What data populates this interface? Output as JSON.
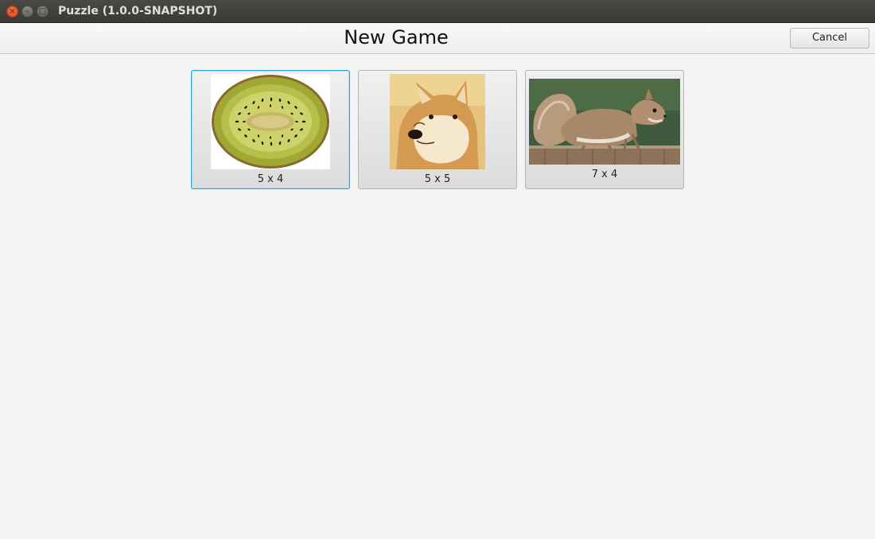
{
  "window": {
    "title": "Puzzle (1.0.0-SNAPSHOT)",
    "controls": {
      "close": "×",
      "minimize": "–",
      "maximize": "□"
    }
  },
  "header": {
    "title": "New Game",
    "cancel_label": "Cancel"
  },
  "puzzles": [
    {
      "image": "kiwi-slice-image",
      "label": "5 x 4",
      "selected": true
    },
    {
      "image": "shiba-inu-dog-image",
      "label": "5 x 5",
      "selected": false
    },
    {
      "image": "squirrel-on-fence-image",
      "label": "7 x 4",
      "selected": false
    }
  ],
  "colors": {
    "selection_border": "#2da3d8",
    "window_background": "#f4f4f4",
    "titlebar": "#3c3b37"
  }
}
